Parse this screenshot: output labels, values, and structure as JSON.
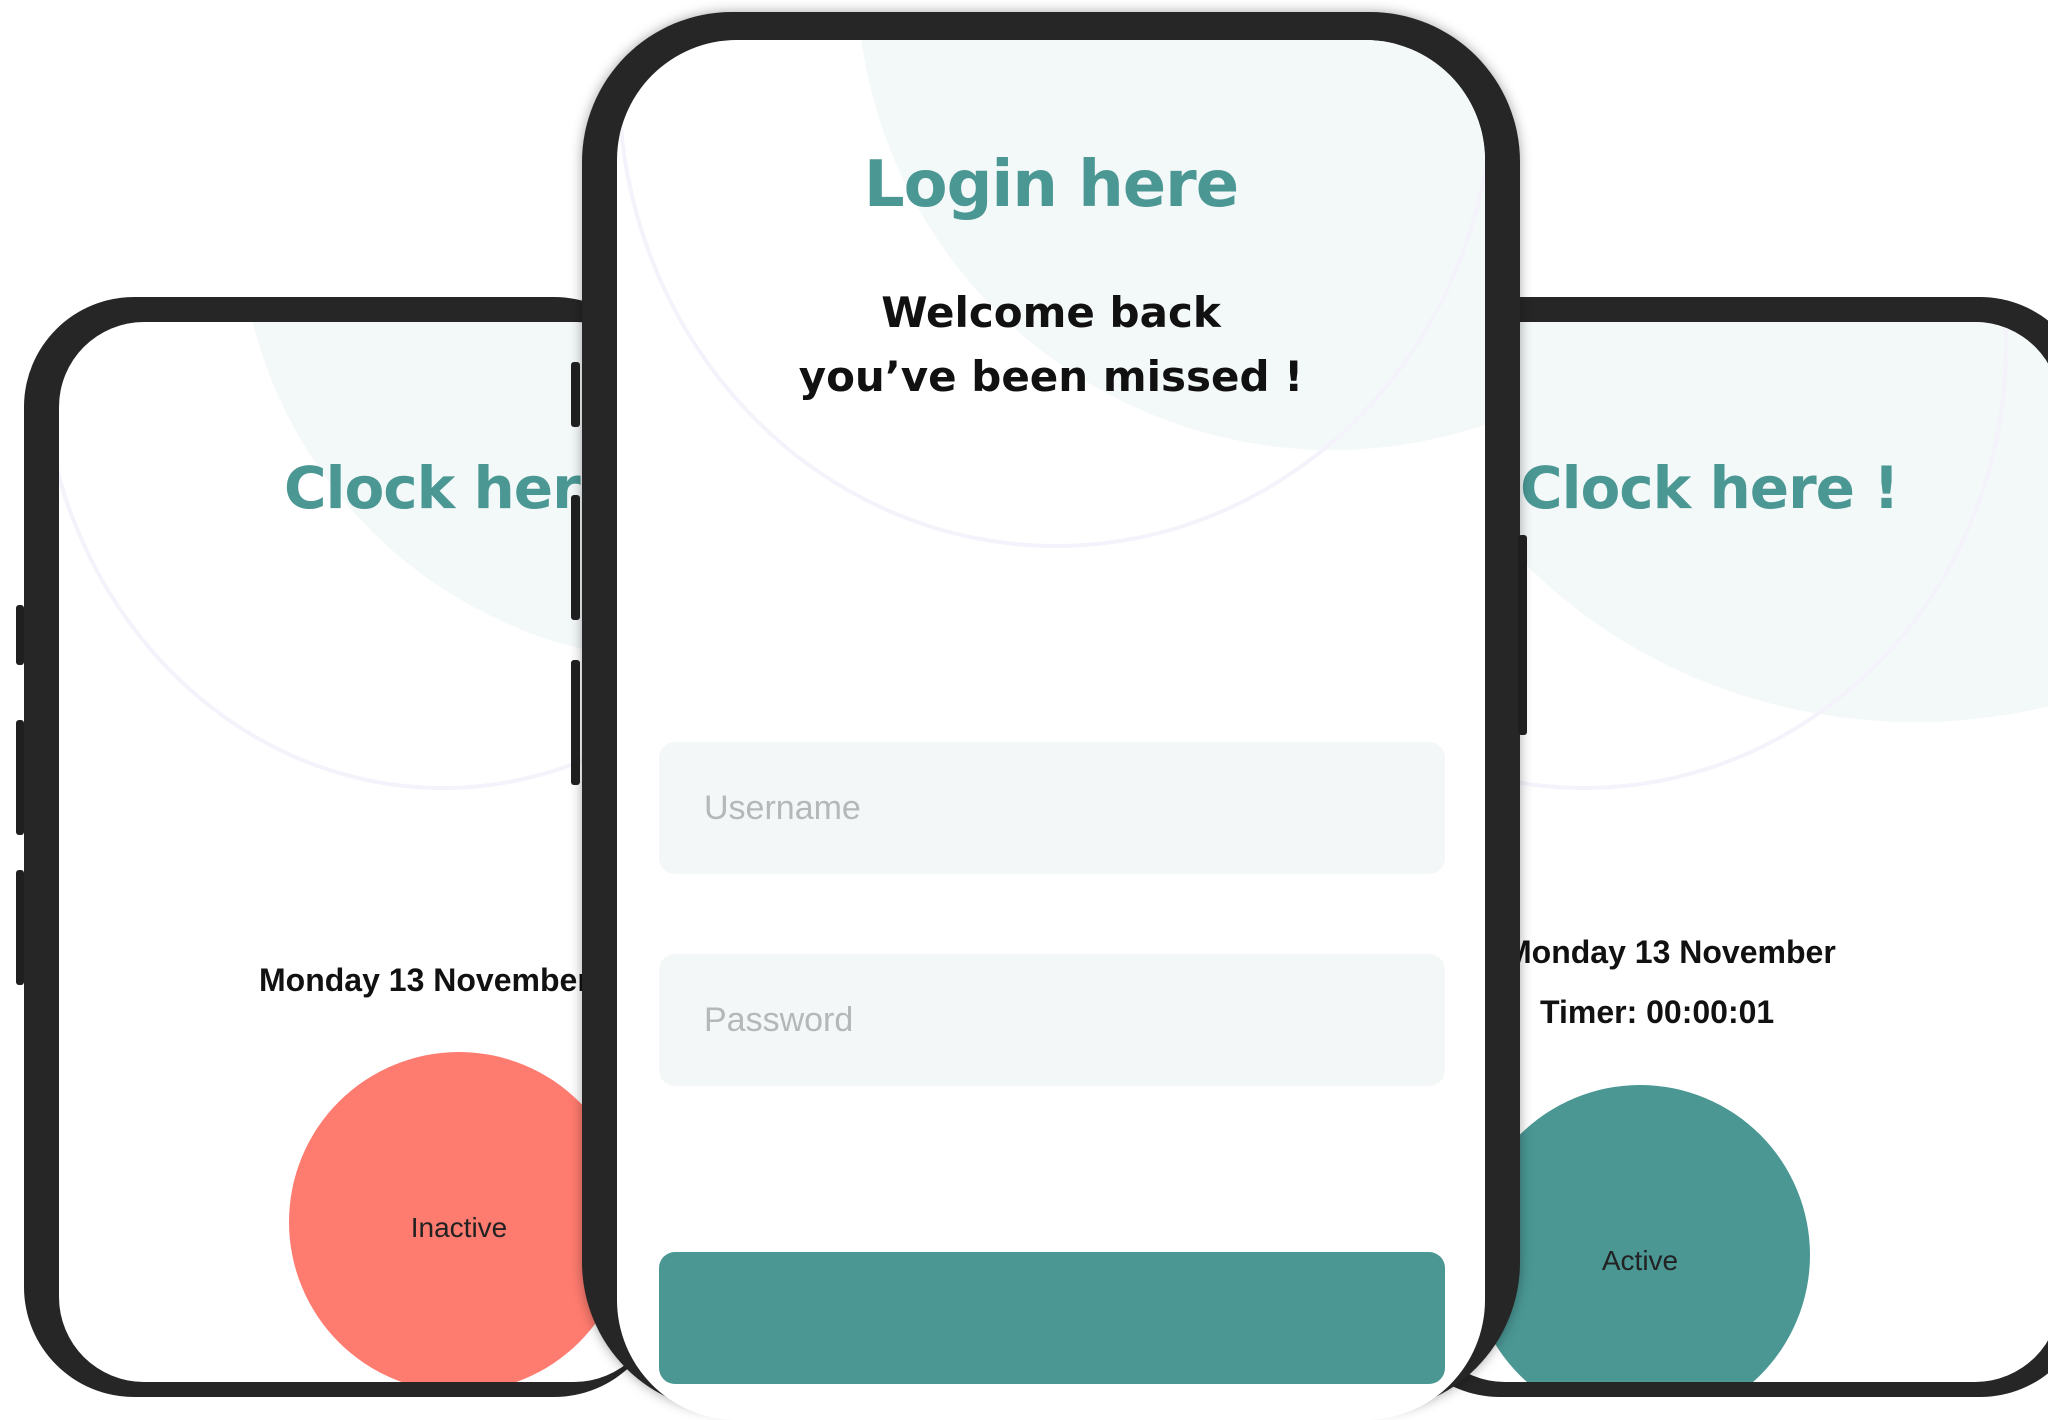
{
  "login_screen": {
    "title": "Login here",
    "welcome_line1": "Welcome back",
    "welcome_line2": "you’ve been missed !",
    "username_placeholder": "Username",
    "password_placeholder": "Password"
  },
  "clock_left": {
    "title": "Clock here",
    "date": "Monday 13 November",
    "status": "Inactive",
    "status_color": "#fe7b6f"
  },
  "clock_right": {
    "title": "Clock here  !",
    "date": "Monday 13 November",
    "timer": "Timer: 00:00:01",
    "status": "Active",
    "status_color": "#4a9794"
  },
  "colors": {
    "accent": "#4a9794",
    "frame": "#262626",
    "field_bg": "#f3f7f7"
  }
}
